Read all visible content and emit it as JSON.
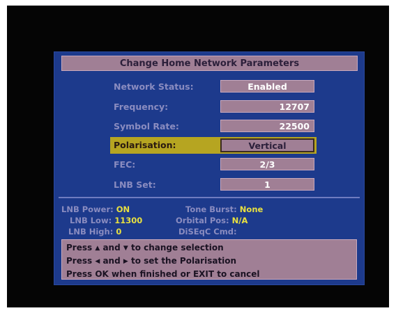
{
  "dialog": {
    "title": "Change Home Network Parameters"
  },
  "fields": [
    {
      "label": "Network Status:",
      "value": "Enabled"
    },
    {
      "label": "Frequency:",
      "value": "12707"
    },
    {
      "label": "Symbol Rate:",
      "value": "22500"
    },
    {
      "label": "Polarisation:",
      "value": "Vertical",
      "selected": true
    },
    {
      "label": "FEC:",
      "value": "2/3"
    },
    {
      "label": "LNB Set:",
      "value": "1"
    }
  ],
  "status": {
    "lnb_power_label": "LNB Power:",
    "lnb_power_value": "ON",
    "lnb_low_label": "LNB Low:",
    "lnb_low_value": "11300",
    "lnb_high_label": "LNB High:",
    "lnb_high_value": "0",
    "tone_burst_label": "Tone Burst:",
    "tone_burst_value": "None",
    "orbital_pos_label": "Orbital Pos:",
    "orbital_pos_value": "N/A",
    "diseqc_label": "DiSEqC Cmd:",
    "diseqc_value": ""
  },
  "help": {
    "line1_a": "Press",
    "line1_b": "and",
    "line1_c": "to change selection",
    "line2_a": "Press",
    "line2_b": "and",
    "line2_c": "to set the Polarisation",
    "line3": "Press OK when finished or EXIT to cancel"
  },
  "colors": {
    "screen": "#050505",
    "panel": "#1d3a8c",
    "box": "#a07f95",
    "highlight": "#b6a521",
    "label": "#8a8cc0",
    "value_accent": "#e8e040"
  },
  "icons": [
    "up-triangle-icon",
    "down-triangle-icon",
    "left-triangle-icon",
    "right-triangle-icon"
  ]
}
